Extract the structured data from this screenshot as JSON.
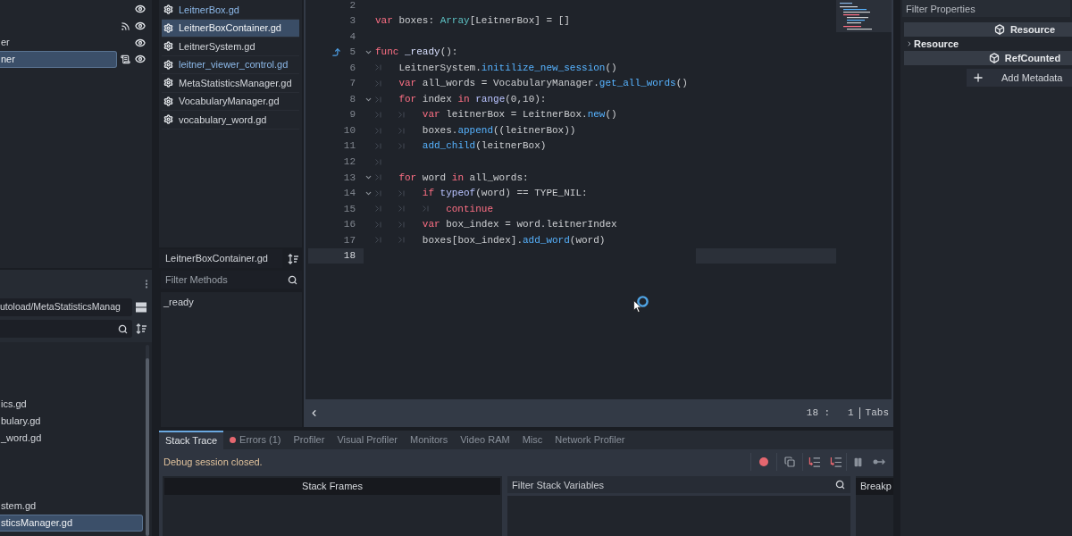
{
  "scene_tree": {
    "rows": [
      {
        "visible": true,
        "signals": false,
        "script": false,
        "selected": false
      },
      {
        "visible": true,
        "signals": true,
        "script": false,
        "selected": false
      },
      {
        "label": "er",
        "visible": true,
        "signals": false,
        "script": false,
        "selected": false
      },
      {
        "label": "ner",
        "visible": true,
        "signals": false,
        "script": true,
        "selected": true
      }
    ]
  },
  "filesystem": {
    "path": "utoload/MetaStatisticsManag",
    "file_groups": [
      [
        {
          "name": "ics.gd",
          "selected": false
        },
        {
          "name": "bulary.gd",
          "selected": false
        },
        {
          "name": "_word.gd",
          "selected": false
        }
      ],
      [
        {
          "name": "stem.gd",
          "selected": false
        },
        {
          "name": "sticsManager.gd",
          "selected": true
        }
      ]
    ]
  },
  "script_list": {
    "items": [
      {
        "name": "LeitnerBox.gd",
        "color": "#8cb8e8",
        "selected": false
      },
      {
        "name": "LeitnerBoxContainer.gd",
        "selected": true
      },
      {
        "name": "LeitnerSystem.gd",
        "color": "#d4d7dc",
        "selected": false
      },
      {
        "name": "leitner_viewer_control.gd",
        "color": "#8cb8e8",
        "selected": false
      },
      {
        "name": "MetaStatisticsManager.gd",
        "color": "#d4d7dc",
        "selected": false
      },
      {
        "name": "VocabularyManager.gd",
        "color": "#d4d7dc",
        "selected": false
      },
      {
        "name": "vocabulary_word.gd",
        "color": "#d4d7dc",
        "selected": false
      }
    ],
    "current_script": "LeitnerBoxContainer.gd",
    "methods_filter": {
      "placeholder": "Filter Methods"
    },
    "methods": [
      "_ready"
    ]
  },
  "editor": {
    "lines": [
      {
        "number": "2",
        "current": false,
        "marker": false,
        "foldable": false
      },
      {
        "number": "3",
        "current": false,
        "marker": false,
        "foldable": false,
        "tokens": [
          {
            "kind": "keyword",
            "text": "var"
          },
          {
            "kind": "plain",
            "text": " boxes: "
          },
          {
            "kind": "type",
            "text": "Array"
          },
          {
            "kind": "plain",
            "text": "[LeitnerBox] = []"
          }
        ]
      },
      {
        "number": "4",
        "current": false,
        "marker": false,
        "foldable": false
      },
      {
        "number": "5",
        "current": false,
        "marker": true,
        "foldable": true,
        "tokens": [
          {
            "kind": "keyword",
            "text": "func"
          },
          {
            "kind": "function",
            "text": " _ready"
          },
          {
            "kind": "plain",
            "text": "():"
          }
        ]
      },
      {
        "number": "6",
        "current": false,
        "marker": false,
        "foldable": false,
        "tokens": [
          {
            "kind": "tab"
          },
          {
            "kind": "plain",
            "text": "LeitnerSystem."
          },
          {
            "kind": "call",
            "text": "initilize_new_session"
          },
          {
            "kind": "plain",
            "text": "()"
          }
        ]
      },
      {
        "number": "7",
        "current": false,
        "marker": false,
        "foldable": false,
        "tokens": [
          {
            "kind": "tab"
          },
          {
            "kind": "keyword",
            "text": "var"
          },
          {
            "kind": "plain",
            "text": " all_words = VocabularyManager."
          },
          {
            "kind": "call",
            "text": "get_all_words"
          },
          {
            "kind": "plain",
            "text": "()"
          }
        ]
      },
      {
        "number": "8",
        "current": false,
        "marker": false,
        "foldable": true,
        "tokens": [
          {
            "kind": "tab"
          },
          {
            "kind": "keyword",
            "text": "for"
          },
          {
            "kind": "plain",
            "text": " index "
          },
          {
            "kind": "keyword",
            "text": "in"
          },
          {
            "kind": "builtin",
            "text": " range"
          },
          {
            "kind": "plain",
            "text": "(0,10):"
          }
        ]
      },
      {
        "number": "9",
        "current": false,
        "marker": false,
        "foldable": false,
        "tokens": [
          {
            "kind": "tab"
          },
          {
            "kind": "tab"
          },
          {
            "kind": "keyword",
            "text": "var"
          },
          {
            "kind": "plain",
            "text": " leitnerBox = LeitnerBox."
          },
          {
            "kind": "call",
            "text": "new"
          },
          {
            "kind": "plain",
            "text": "()"
          }
        ]
      },
      {
        "number": "10",
        "current": false,
        "marker": false,
        "foldable": false,
        "tokens": [
          {
            "kind": "tab"
          },
          {
            "kind": "tab"
          },
          {
            "kind": "plain",
            "text": "boxes."
          },
          {
            "kind": "call",
            "text": "append"
          },
          {
            "kind": "plain",
            "text": "((leitnerBox))"
          }
        ]
      },
      {
        "number": "11",
        "current": false,
        "marker": false,
        "foldable": false,
        "tokens": [
          {
            "kind": "tab"
          },
          {
            "kind": "tab"
          },
          {
            "kind": "call",
            "text": "add_child"
          },
          {
            "kind": "plain",
            "text": "(leitnerBox)"
          }
        ]
      },
      {
        "number": "12",
        "current": false,
        "marker": false,
        "foldable": false,
        "tokens": [
          {
            "kind": "tab"
          }
        ]
      },
      {
        "number": "13",
        "current": false,
        "marker": false,
        "foldable": true,
        "tokens": [
          {
            "kind": "tab"
          },
          {
            "kind": "keyword",
            "text": "for"
          },
          {
            "kind": "plain",
            "text": " word "
          },
          {
            "kind": "keyword",
            "text": "in"
          },
          {
            "kind": "plain",
            "text": " all_words:"
          }
        ]
      },
      {
        "number": "14",
        "current": false,
        "marker": false,
        "foldable": true,
        "tokens": [
          {
            "kind": "tab"
          },
          {
            "kind": "tab"
          },
          {
            "kind": "keyword",
            "text": "if"
          },
          {
            "kind": "builtin",
            "text": " typeof"
          },
          {
            "kind": "plain",
            "text": "(word) == TYPE_NIL:"
          }
        ]
      },
      {
        "number": "15",
        "current": false,
        "marker": false,
        "foldable": false,
        "tokens": [
          {
            "kind": "tab"
          },
          {
            "kind": "tab"
          },
          {
            "kind": "tab"
          },
          {
            "kind": "keyword",
            "text": "continue"
          }
        ]
      },
      {
        "number": "16",
        "current": false,
        "marker": false,
        "foldable": false,
        "tokens": [
          {
            "kind": "tab"
          },
          {
            "kind": "tab"
          },
          {
            "kind": "keyword",
            "text": "var"
          },
          {
            "kind": "plain",
            "text": " box_index = word.leitnerIndex"
          }
        ]
      },
      {
        "number": "17",
        "current": false,
        "marker": false,
        "foldable": false,
        "tokens": [
          {
            "kind": "tab"
          },
          {
            "kind": "tab"
          },
          {
            "kind": "plain",
            "text": "boxes[box_index]."
          },
          {
            "kind": "call",
            "text": "add_word"
          },
          {
            "kind": "plain",
            "text": "(word)"
          }
        ]
      },
      {
        "number": "18",
        "current": true,
        "marker": false,
        "foldable": false
      }
    ],
    "caret_position": "18 :   1",
    "indentation": "Tabs"
  },
  "bottom_panel": {
    "tabs": [
      {
        "label": "Stack Trace",
        "selected": true
      },
      {
        "label": "Errors (1)",
        "selected": false,
        "color": "#e5676f"
      },
      {
        "label": "Profiler",
        "selected": false
      },
      {
        "label": "Visual Profiler",
        "selected": false
      },
      {
        "label": "Monitors",
        "selected": false
      },
      {
        "label": "Video RAM",
        "selected": false
      },
      {
        "label": "Misc",
        "selected": false
      },
      {
        "label": "Network Profiler",
        "selected": false
      }
    ],
    "status": "Debug session closed.",
    "stack_frames_header": "Stack Frames",
    "variables_filter": {
      "placeholder": "Filter Stack Variables"
    },
    "breakpoints_header": "Breakp"
  },
  "inspector": {
    "filter": {
      "placeholder": "Filter Properties"
    },
    "rows": [
      {
        "kind": "category",
        "label": "Resource"
      },
      {
        "kind": "section",
        "label": "Resource",
        "expanded": false
      },
      {
        "kind": "category",
        "label": "RefCounted"
      }
    ],
    "add_metadata": "Add Metadata"
  }
}
